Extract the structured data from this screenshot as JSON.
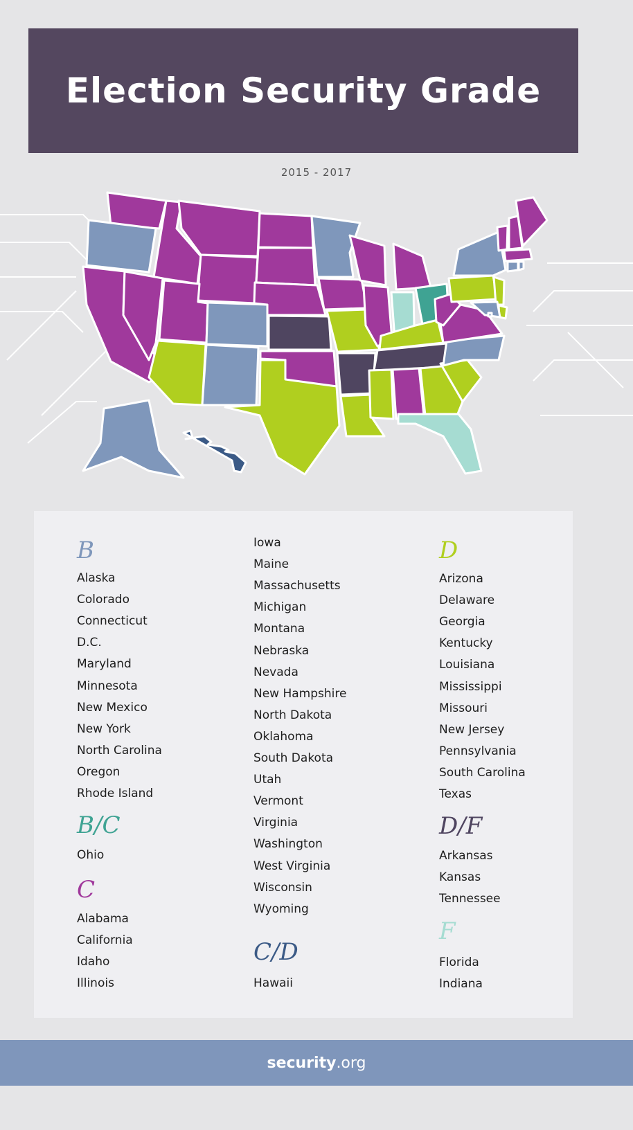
{
  "header": {
    "title": "Election Security Grade",
    "subtitle": "2015 - 2017"
  },
  "grades": [
    {
      "grade": "B",
      "color": "#7f97bb",
      "states": [
        "Alaska",
        "Colorado",
        "Connecticut",
        "D.C.",
        "Maryland",
        "Minnesota",
        "New Mexico",
        "New York",
        "North Carolina",
        "Oregon",
        "Rhode Island"
      ]
    },
    {
      "grade": "B/C",
      "color": "#3fa393",
      "states": [
        "Ohio"
      ]
    },
    {
      "grade": "C",
      "color": "#a0399c",
      "states": [
        "Alabama",
        "California",
        "Idaho",
        "Illinois",
        "Iowa",
        "Maine",
        "Massachusetts",
        "Michigan",
        "Montana",
        "Nebraska",
        "Nevada",
        "New Hampshire",
        "North Dakota",
        "Oklahoma",
        "South Dakota",
        "Utah",
        "Vermont",
        "Virginia",
        "Washington",
        "West Virginia",
        "Wisconsin",
        "Wyoming"
      ]
    },
    {
      "grade": "C/D",
      "color": "#3b5a86",
      "states": [
        "Hawaii"
      ]
    },
    {
      "grade": "D",
      "color": "#b0cf1f",
      "states": [
        "Arizona",
        "Delaware",
        "Georgia",
        "Kentucky",
        "Louisiana",
        "Mississippi",
        "Missouri",
        "New Jersey",
        "Pennsylvania",
        "South Carolina",
        "Texas"
      ]
    },
    {
      "grade": "D/F",
      "color": "#4f4560",
      "states": [
        "Arkansas",
        "Kansas",
        "Tennessee"
      ]
    },
    {
      "grade": "F",
      "color": "#a6dcd2",
      "states": [
        "Florida",
        "Indiana"
      ]
    }
  ],
  "footer": {
    "brand_bold": "security",
    "brand_rest": ".org"
  }
}
